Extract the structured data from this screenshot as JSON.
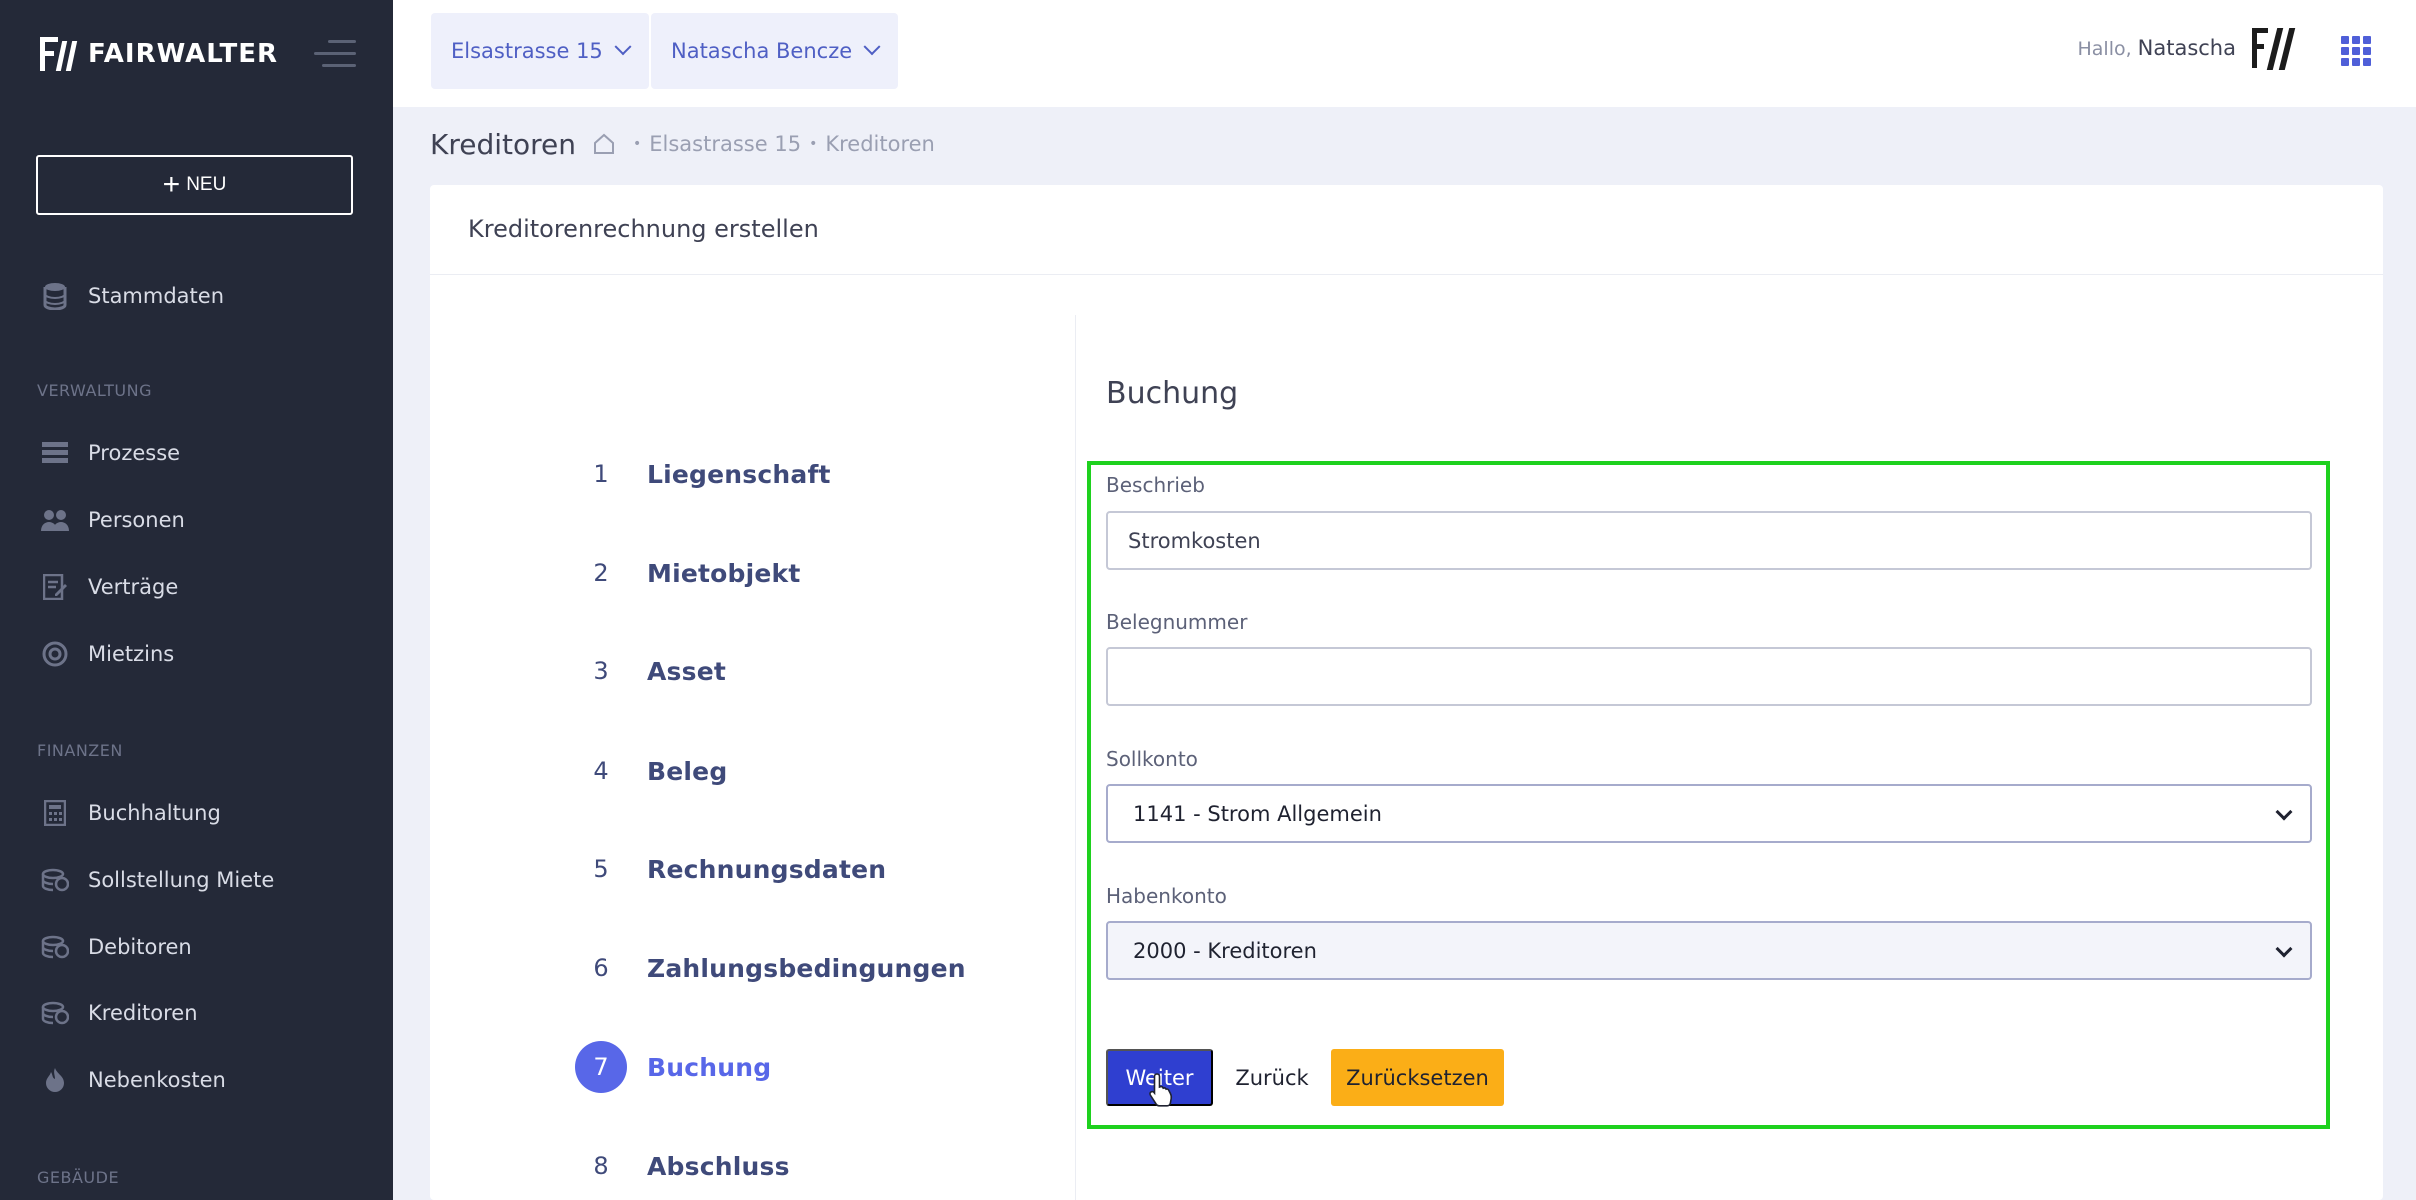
{
  "brand": {
    "name": "FAIRWALTER"
  },
  "sidebar": {
    "new_button": "NEU",
    "items_top": [
      {
        "label": "Stammdaten",
        "icon": "database-icon"
      }
    ],
    "sections": [
      {
        "title": "VERWALTUNG",
        "items": [
          {
            "label": "Prozesse",
            "icon": "list-icon"
          },
          {
            "label": "Personen",
            "icon": "people-icon"
          },
          {
            "label": "Verträge",
            "icon": "contract-icon"
          },
          {
            "label": "Mietzins",
            "icon": "rent-icon"
          }
        ]
      },
      {
        "title": "FINANZEN",
        "items": [
          {
            "label": "Buchhaltung",
            "icon": "calculator-icon"
          },
          {
            "label": "Sollstellung Miete",
            "icon": "coins-icon"
          },
          {
            "label": "Debitoren",
            "icon": "coins-icon"
          },
          {
            "label": "Kreditoren",
            "icon": "coins-icon"
          },
          {
            "label": "Nebenkosten",
            "icon": "flame-icon"
          }
        ]
      },
      {
        "title": "GEBÄUDE",
        "items": []
      }
    ]
  },
  "header": {
    "property_select": "Elsastrasse 15",
    "user_select": "Natascha Bencze",
    "greeting": "Hallo,",
    "user_name": "Natascha"
  },
  "subheader": {
    "title": "Kreditoren",
    "breadcrumb": [
      "Elsastrasse 15",
      "Kreditoren"
    ]
  },
  "card": {
    "title": "Kreditorenrechnung erstellen",
    "steps": [
      {
        "num": "1",
        "label": "Liegenschaft"
      },
      {
        "num": "2",
        "label": "Mietobjekt"
      },
      {
        "num": "3",
        "label": "Asset"
      },
      {
        "num": "4",
        "label": "Beleg"
      },
      {
        "num": "5",
        "label": "Rechnungsdaten"
      },
      {
        "num": "6",
        "label": "Zahlungsbedingungen"
      },
      {
        "num": "7",
        "label": "Buchung"
      },
      {
        "num": "8",
        "label": "Abschluss"
      }
    ],
    "active_step": 7
  },
  "form": {
    "title": "Buchung",
    "beschrieb": {
      "label": "Beschrieb",
      "value": "Stromkosten"
    },
    "belegnummer": {
      "label": "Belegnummer",
      "value": ""
    },
    "sollkonto": {
      "label": "Sollkonto",
      "value": "1141 - Strom Allgemein"
    },
    "habenkonto": {
      "label": "Habenkonto",
      "value": "2000 - Kreditoren"
    },
    "buttons": {
      "next": "Weiter",
      "back": "Zurück",
      "reset": "Zurücksetzen"
    }
  },
  "colors": {
    "highlight": "#1ed11e",
    "primary": "#2f3fd0",
    "warning": "#fbae17",
    "active_step": "#5867e8"
  }
}
